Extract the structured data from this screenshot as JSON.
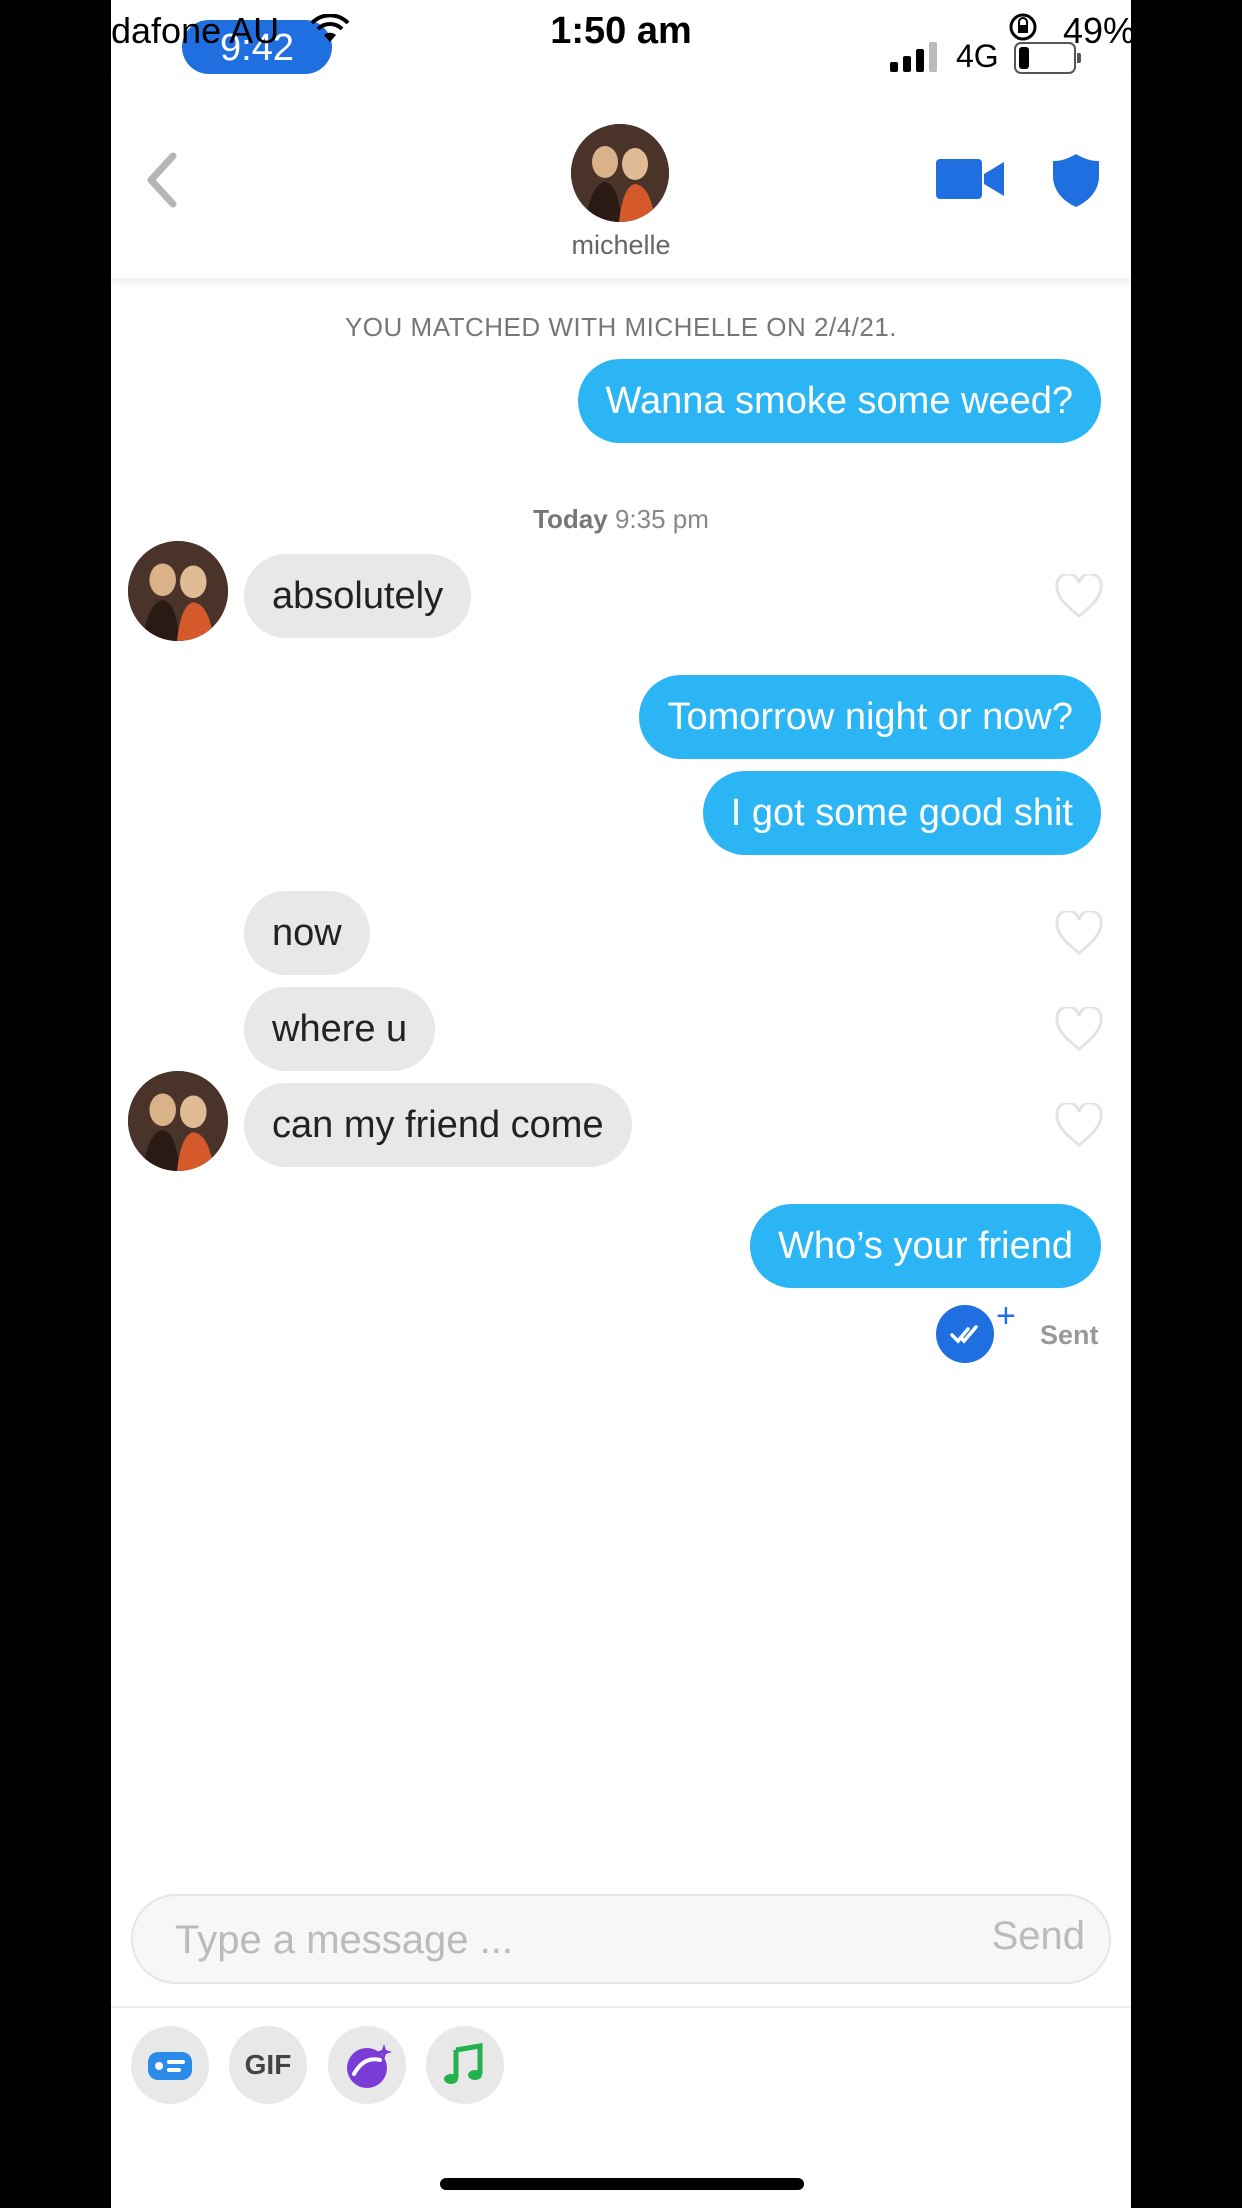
{
  "outer_status": {
    "carrier": "dafone AU",
    "time": "1:50 am",
    "battery": "49%"
  },
  "recording_pill": {
    "time": "9:42"
  },
  "inner_status": {
    "network": "4G",
    "signal_bars": 3,
    "battery_level": 0.15
  },
  "header": {
    "name": "michelle",
    "icons": [
      "back-chevron-icon",
      "video-icon",
      "shield-icon"
    ]
  },
  "chat": {
    "match_note": "YOU MATCHED WITH MICHELLE ON 2/4/21.",
    "day_label": "Today",
    "day_time": "9:35 pm",
    "messages": [
      {
        "from": "me",
        "text": "Wanna smoke some weed?"
      },
      {
        "from": "them",
        "text": "absolutely"
      },
      {
        "from": "me",
        "text": "Tomorrow night or now?"
      },
      {
        "from": "me",
        "text": "I got some good shit"
      },
      {
        "from": "them",
        "text": "now"
      },
      {
        "from": "them",
        "text": "where u"
      },
      {
        "from": "them",
        "text": "can my friend come"
      },
      {
        "from": "me",
        "text": "Who’s your friend"
      }
    ],
    "sent_status": "Sent"
  },
  "composer": {
    "placeholder": "Type a message ...",
    "send_label": "Send"
  },
  "toolbar": {
    "gif_label": "GIF",
    "tools": [
      "contact-card-icon",
      "gif-icon",
      "sticker-icon",
      "music-note-icon"
    ]
  },
  "colors": {
    "outgoing_bubble": "#2bb5f5",
    "incoming_bubble": "#e8e8e8",
    "accent_blue": "#1f6fe0"
  }
}
